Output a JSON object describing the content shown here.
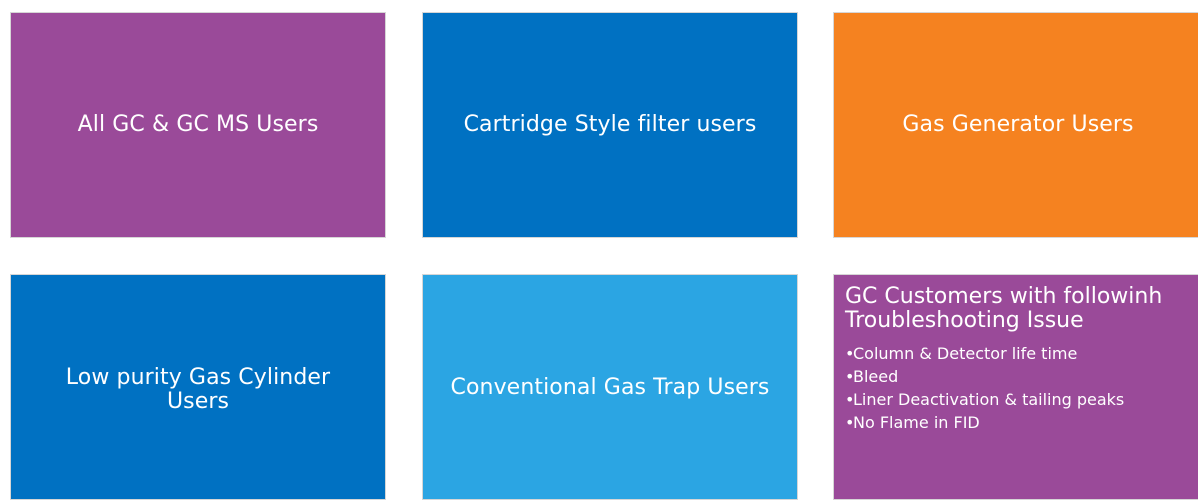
{
  "tiles": [
    {
      "label": "All GC & GC MS Users",
      "color": "#9a4a99"
    },
    {
      "label": "Cartridge Style filter users",
      "color": "#0071c2"
    },
    {
      "label": "Gas Generator Users",
      "color": "#f58220"
    },
    {
      "label_line1": "Low purity Gas Cylinder",
      "label_line2": "Users",
      "color": "#0071c2"
    },
    {
      "label": "Conventional Gas Trap Users",
      "color": "#2ba5e3"
    },
    {
      "title_line1": "GC Customers with followinh",
      "title_line2": "Troubleshooting Issue",
      "bullets": [
        "Column & Detector life time",
        "Bleed",
        "Liner Deactivation & tailing peaks",
        "No Flame in FID"
      ],
      "color": "#9a4a99"
    }
  ]
}
